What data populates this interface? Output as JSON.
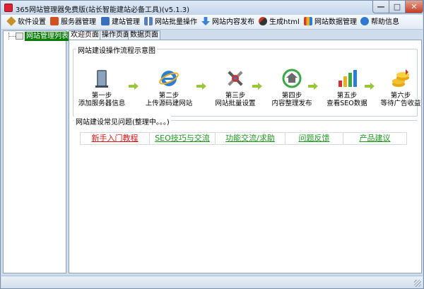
{
  "window": {
    "title": "365网站管理器免费版(站长智能建站必备工具)(v5.1.3)",
    "controls": {
      "minimize": "—",
      "maximize": "□",
      "close": "✕"
    }
  },
  "menu": {
    "items": [
      {
        "label": "软件设置",
        "icon": "wrench-icon",
        "color": "#c8902a"
      },
      {
        "label": "服务器管理",
        "icon": "server-icon",
        "color": "#d05020"
      },
      {
        "label": "建站管理",
        "icon": "pen-icon",
        "color": "#3a6fc0"
      },
      {
        "label": "网站批量操作",
        "icon": "grid-icon",
        "color": "#5a7fbf"
      },
      {
        "label": "网站内容发布",
        "icon": "down-arrow-icon",
        "color": "#3b82d6"
      },
      {
        "label": "生成html",
        "icon": "magic-wand-icon",
        "color": "#c83a2a"
      },
      {
        "label": "网站数据管理",
        "icon": "bar-chart-icon",
        "color": "#d23a2a"
      },
      {
        "label": "帮助信息",
        "icon": "info-icon",
        "color": "#2f79d0"
      }
    ]
  },
  "sidebar": {
    "tree_node": "网站管理列表",
    "node_color": "#0a7d0a"
  },
  "tabs": [
    {
      "label": "欢迎页面",
      "active": true
    },
    {
      "label": "操作页面",
      "active": false
    },
    {
      "label": "数据页面",
      "active": false
    }
  ],
  "workflow": {
    "title": "网站建设操作流程示意图",
    "steps": [
      {
        "line1": "第一步",
        "line2": "添加服务器信息",
        "icon": "server-tower-icon"
      },
      {
        "line1": "第二步",
        "line2": "上传源码建网站",
        "icon": "ie-browser-icon"
      },
      {
        "line1": "第三步",
        "line2": "网站批量设置",
        "icon": "tools-icon"
      },
      {
        "line1": "第四步",
        "line2": "内容整理发布",
        "icon": "home-recycle-icon"
      },
      {
        "line1": "第五步",
        "line2": "查看SEO数据",
        "icon": "bar-chart-icon"
      },
      {
        "line1": "第六步",
        "line2": "等待广告收益",
        "icon": "gold-coins-icon"
      }
    ],
    "arrow_color": "#9ac63a"
  },
  "faq": {
    "title": "网站建设常见问题(整理中。。。)",
    "links": [
      {
        "label": "新手入门教程",
        "color": "#e01818"
      },
      {
        "label": "SEO技巧与交流",
        "color": "#1a9a1a"
      },
      {
        "label": "功能交流/求助",
        "color": "#1a9a1a"
      },
      {
        "label": "问题反馈",
        "color": "#1a9a1a"
      },
      {
        "label": "产品建议",
        "color": "#1a9a1a"
      }
    ]
  }
}
